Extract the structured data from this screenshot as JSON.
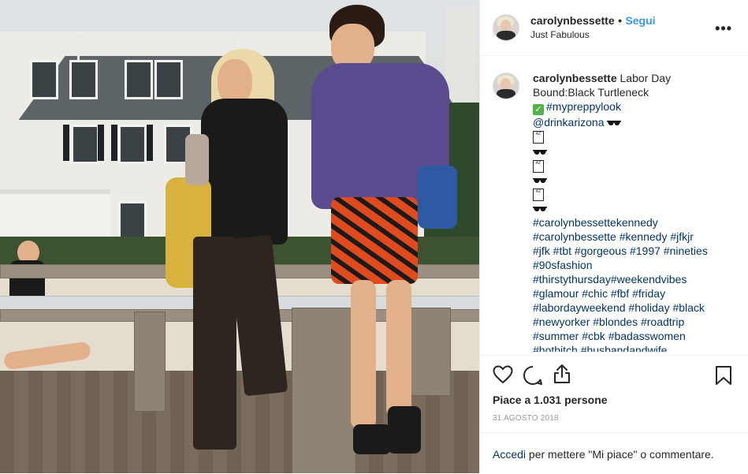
{
  "post": {
    "username": "carolynbessette",
    "separator": "•",
    "follow_label": "Segui",
    "location": "Just Fabulous",
    "more_label": "•••"
  },
  "caption": {
    "username": "carolynbessette",
    "text_1": "Labor Day",
    "text_2": "Bound:Black Turtleneck",
    "hashtag_1": "#mypreppylook",
    "mention": "@drinkarizona",
    "can_label": "AZ",
    "hashtags": [
      "#carolynbessettekennedy",
      "#carolynbessette #kennedy #jfkjr",
      "#jfk #tbt #gorgeous #1997 #nineties",
      "#90sfashion",
      "#thirstythursday#weekendvibes",
      "#glamour #chic #fbf #friday",
      "#labordayweekend #holiday #black",
      "#newyorker #blondes #roadtrip",
      "#summer #cbk #badasswomen",
      "#hotbitch #husbandandwife"
    ]
  },
  "actions": {
    "likes": "Piace a 1.031 persone",
    "date": "31 AGOSTO 2018"
  },
  "footer": {
    "login_link": "Accedi",
    "login_rest": " per mettere \"Mi piace\" o commentare."
  },
  "colors": {
    "link_blue": "#3897f0",
    "hashtag": "#003569",
    "border": "#efefef",
    "muted": "#999999"
  },
  "icons": [
    "heart-icon",
    "comment-icon",
    "share-icon",
    "bookmark-icon",
    "more-icon",
    "check-emoji-icon",
    "sunglasses-emoji-icon",
    "can-emoji-icon"
  ]
}
